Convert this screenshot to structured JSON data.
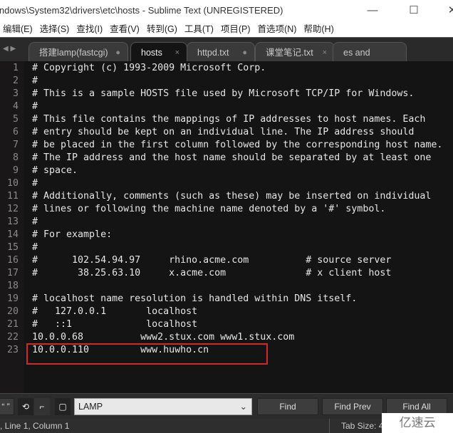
{
  "window": {
    "title": "indows\\System32\\drivers\\etc\\hosts - Sublime Text (UNREGISTERED)",
    "minimize": "—",
    "maximize": "☐",
    "close": "✕"
  },
  "menu": [
    "编辑(E)",
    "选择(S)",
    "查找(I)",
    "查看(V)",
    "转到(G)",
    "工具(T)",
    "项目(P)",
    "首选项(N)",
    "帮助(H)"
  ],
  "tabs": [
    {
      "label": "搭建lamp(fastcgi)",
      "mark": "●",
      "active": false
    },
    {
      "label": "hosts",
      "mark": "×",
      "active": true
    },
    {
      "label": "httpd.txt",
      "mark": "●",
      "active": false
    },
    {
      "label": "课堂笔记.txt",
      "mark": "×",
      "active": false
    },
    {
      "label": "es and Security.txt",
      "mark": "●",
      "active": false
    }
  ],
  "editor": {
    "lines": [
      "# Copyright (c) 1993-2009 Microsoft Corp.",
      "#",
      "# This is a sample HOSTS file used by Microsoft TCP/IP for Windows.",
      "#",
      "# This file contains the mappings of IP addresses to host names. Each",
      "# entry should be kept on an individual line. The IP address should",
      "# be placed in the first column followed by the corresponding host name.",
      "# The IP address and the host name should be separated by at least one",
      "# space.",
      "#",
      "# Additionally, comments (such as these) may be inserted on individual",
      "# lines or following the machine name denoted by a '#' symbol.",
      "#",
      "# For example:",
      "#",
      "#      102.54.94.97     rhino.acme.com          # source server",
      "#       38.25.63.10     x.acme.com              # x client host",
      "",
      "# localhost name resolution is handled within DNS itself.",
      "#   127.0.0.1       localhost",
      "#   ::1             localhost",
      "10.0.0.68          www2.stux.com www1.stux.com",
      "10.0.0.110         www.huwho.cn"
    ],
    "highlight_color": "#d42828"
  },
  "findbar": {
    "quote_label": "“ ”",
    "query": "LAMP",
    "find": "Find",
    "find_prev": "Find Prev",
    "find_all": "Find All"
  },
  "status": {
    "position": ", Line 1, Column 1",
    "tab_size": "Tab Size: 4"
  },
  "watermark": "亿速云"
}
